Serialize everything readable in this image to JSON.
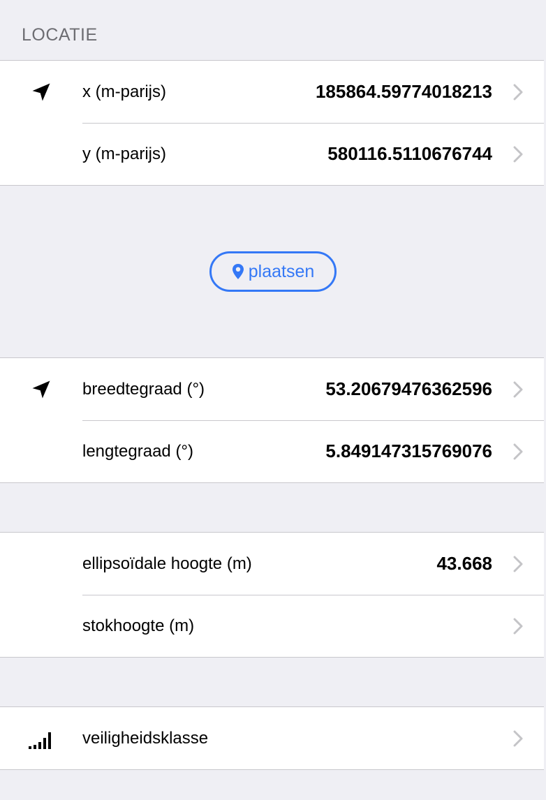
{
  "section": {
    "title": "LOCATIE"
  },
  "rd_group": {
    "rows": [
      {
        "label": "x (m-parijs)",
        "value": "185864.59774018213"
      },
      {
        "label": "y (m-parijs)",
        "value": "580116.5110676744"
      }
    ]
  },
  "place_button": {
    "label": "plaatsen"
  },
  "latlon_group": {
    "rows": [
      {
        "label": "breedtegraad (°)",
        "value": "53.20679476362596"
      },
      {
        "label": "lengtegraad (°)",
        "value": "5.849147315769076"
      }
    ]
  },
  "height_group": {
    "rows": [
      {
        "label": "ellipsoïdale hoogte (m)",
        "value": "43.668"
      },
      {
        "label": "stokhoogte (m)",
        "value": ""
      }
    ]
  },
  "safety_group": {
    "rows": [
      {
        "label": "veiligheidsklasse",
        "value": ""
      }
    ]
  },
  "icons": {
    "location": "location-arrow-icon",
    "signal": "signal-bars-icon",
    "chevron": "chevron-right-icon",
    "pin": "map-pin-icon"
  },
  "colors": {
    "accent": "#3478f6",
    "background": "#efeff4",
    "separator": "#c8c7cc"
  }
}
